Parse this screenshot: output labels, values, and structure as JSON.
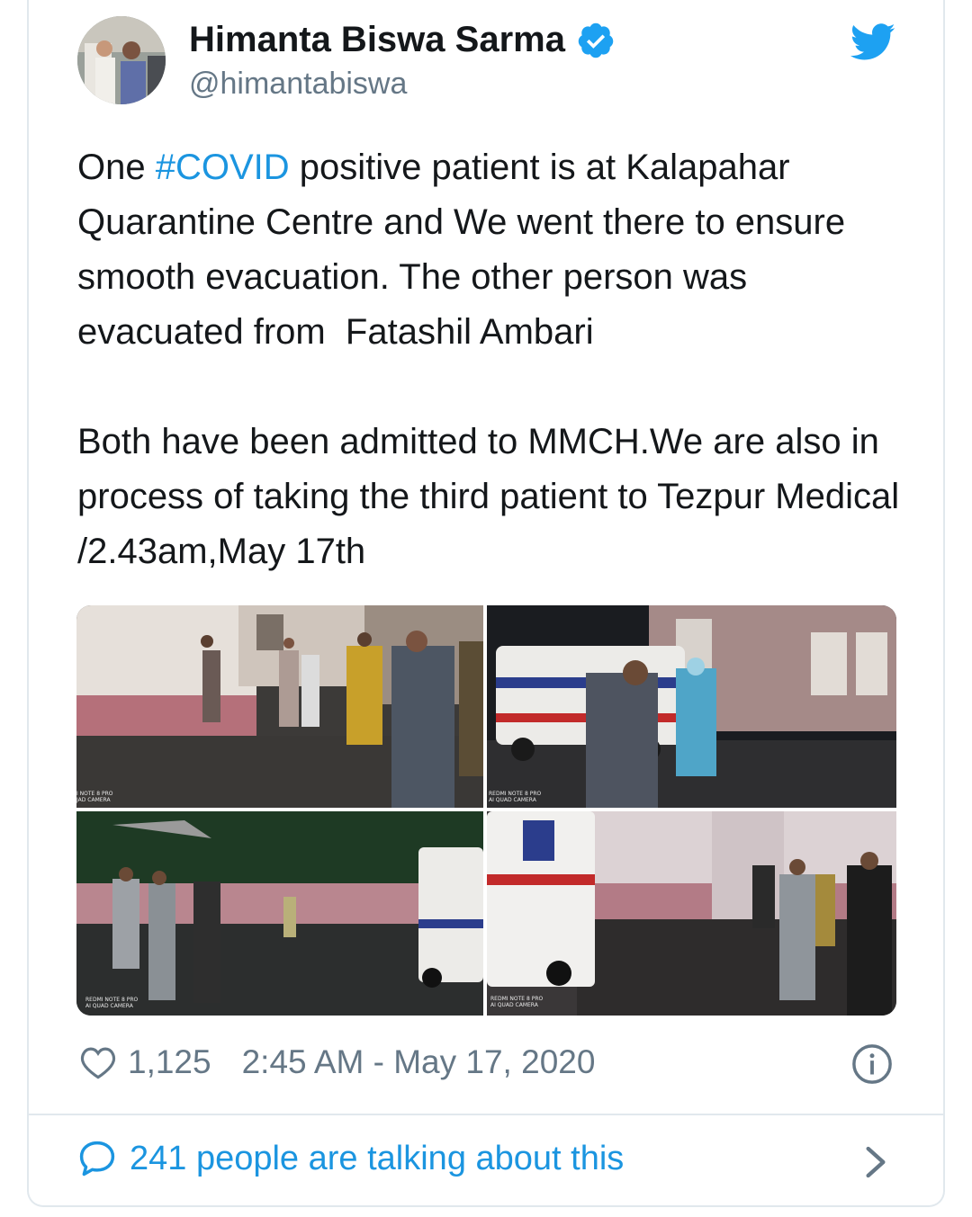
{
  "author": {
    "name": "Himanta Biswa Sarma",
    "handle": "@himantabiswa"
  },
  "icons": {
    "verified": "verified-badge-icon",
    "brand": "twitter-bird-icon",
    "like": "heart-icon",
    "info": "info-icon",
    "reply": "chat-bubble-icon",
    "more": "chevron-right-icon"
  },
  "colors": {
    "accent": "#1b95e0",
    "text": "#14171a",
    "secondary": "#657786",
    "border": "#e1e8ed"
  },
  "tweet": {
    "text_before_hashtag": "One ",
    "hashtag": "#COVID",
    "text_after_hashtag": " positive patient is at Kalapahar Quarantine Centre and We went there to ensure smooth evacuation. The other person was evacuated from  Fatashil Ambari\n\nBoth have been admitted to MMCH.We are also in process of taking the third patient to Tezpur Medical /2.43am,May 17th"
  },
  "photos": [
    {
      "watermark": "I NOTE 8 PRO\nJAD CAMERA"
    },
    {
      "watermark": "REDMI NOTE 8 PRO\nAI QUAD CAMERA"
    },
    {
      "watermark": "REDMI NOTE 8 PRO\nAI QUAD CAMERA"
    },
    {
      "watermark": "REDMI NOTE 8 PRO\nAI QUAD CAMERA"
    }
  ],
  "meta": {
    "likes": "1,125",
    "timestamp": "2:45 AM - May 17, 2020"
  },
  "footer": {
    "talking_label": "241 people are talking about this"
  }
}
